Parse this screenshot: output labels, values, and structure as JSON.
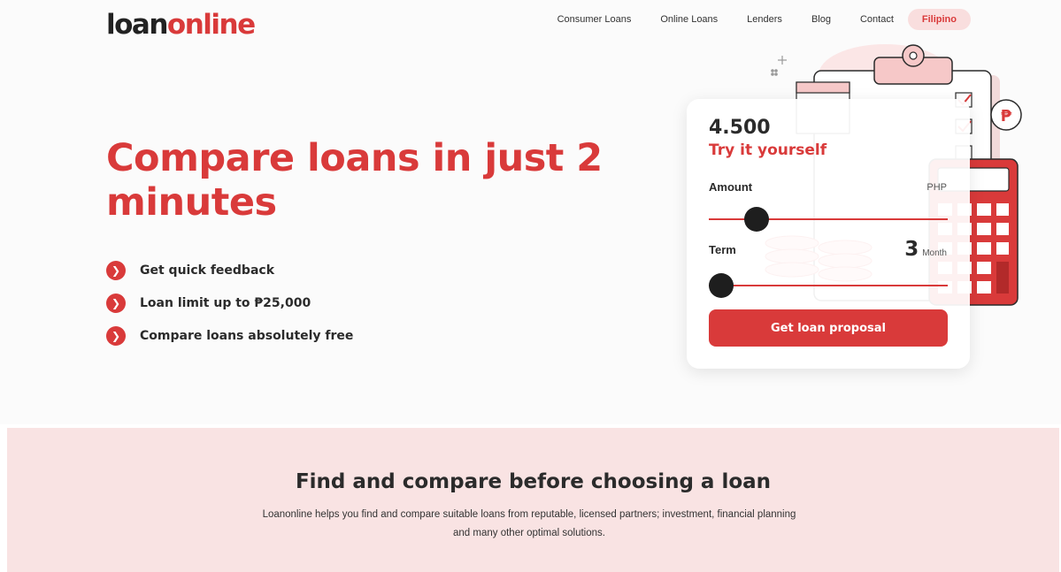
{
  "header": {
    "logo_part1": "loan",
    "logo_part2": "online",
    "nav": [
      "Consumer Loans",
      "Online Loans",
      "Lenders",
      "Blog",
      "Contact"
    ],
    "language": "Filipino"
  },
  "hero": {
    "title": "Compare loans in just 2 minutes",
    "features": [
      "Get quick feedback",
      "Loan limit up to ₱25,000",
      "Compare loans absolutely free"
    ]
  },
  "calculator": {
    "amount_value": "4.500",
    "tagline": "Try it yourself",
    "amount_label": "Amount",
    "currency": "PHP",
    "amount_slider_level": 0.2,
    "term_label": "Term",
    "term_value": "3",
    "term_unit": "Month",
    "term_slider_level": 0.05,
    "cta_label": "Get loan proposal"
  },
  "section2": {
    "title": "Find and compare before choosing a loan",
    "description": "Loanonline helps you find and compare suitable loans from reputable, licensed partners; investment, financial planning and many other optimal solutions."
  },
  "colors": {
    "accent": "#d93a3a",
    "accent_light": "#f9e3e3",
    "text_dark": "#2b2b2b"
  }
}
